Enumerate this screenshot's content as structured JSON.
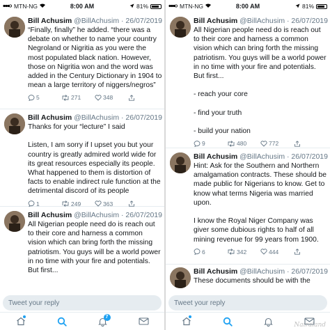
{
  "status": {
    "carrier": "MTN-NG",
    "time": "8:00 AM",
    "battery": "81%",
    "battery_level": 0.81
  },
  "left_tweets": [
    {
      "name": "Bill Achusim",
      "handle": "@BillAchusim",
      "date": "· 26/07/2019",
      "text": "“Finally, finally” he added. “there was a debate on whether to name your country Negroland or Nigritia as you were the most populated black nation. However, those on Nigritia won and the word was added in the Century Dictionary in 1904 to mean a large territory of niggers/negros”",
      "replies": "5",
      "retweets": "271",
      "likes": "348"
    },
    {
      "name": "Bill Achusim",
      "handle": "@BillAchusim",
      "date": "· 26/07/2019",
      "text": "Thanks for your “lecture” I said\n\nListen, I am sorry if I upset you but your country is greatly admired world wide for its great resources especially its people. What happened to them is distortion of facts to enable indirect rule function at the detrimental discord of its people",
      "replies": "1",
      "retweets": "249",
      "likes": "363"
    },
    {
      "name": "Bill Achusim",
      "handle": "@BillAchusim",
      "date": "· 26/07/2019",
      "text": "All Nigerian people need do is reach out to their core and harness a common vision which can bring forth the missing patriotism. You guys will be a world power in no time with your fire and potentials. But first...",
      "replies": "",
      "retweets": "",
      "likes": ""
    }
  ],
  "right_tweets": [
    {
      "name": "Bill Achusim",
      "handle": "@BillAchusim",
      "date": "· 26/07/2019",
      "text": "All Nigerian people need do is reach out to their core and harness a common vision which can bring forth the missing patriotism. You guys will be a world power in no time with your fire and potentials. But first...\n\n- reach your core\n\n- find your truth\n\n- build your nation",
      "replies": "9",
      "retweets": "480",
      "likes": "772"
    },
    {
      "name": "Bill Achusim",
      "handle": "@BillAchusim",
      "date": "· 26/07/2019",
      "text": "Hint: Ask for the Southern and Northern amalgamation contracts. These should be made public for Nigerians to know. Get to know what terms Nigeria was married upon.\n\nI know the Royal Niger Company was giver some dubious rights to half of all mining revenue for 99 years from 1900.",
      "replies": "6",
      "retweets": "342",
      "likes": "444"
    },
    {
      "name": "Bill Achusim",
      "handle": "@BillAchusim",
      "date": "· 26/07/2019",
      "text": "These documents should be with the",
      "replies": "",
      "retweets": "",
      "likes": ""
    }
  ],
  "reply_placeholder": "Tweet your reply",
  "notifications_badge": "7",
  "watermark": "Nairaland",
  "icons": {
    "home": "home-icon",
    "search": "search-icon",
    "notifications": "bell-icon",
    "messages": "mail-icon"
  },
  "colors": {
    "accent": "#1da1f2",
    "text_secondary": "#657786"
  }
}
